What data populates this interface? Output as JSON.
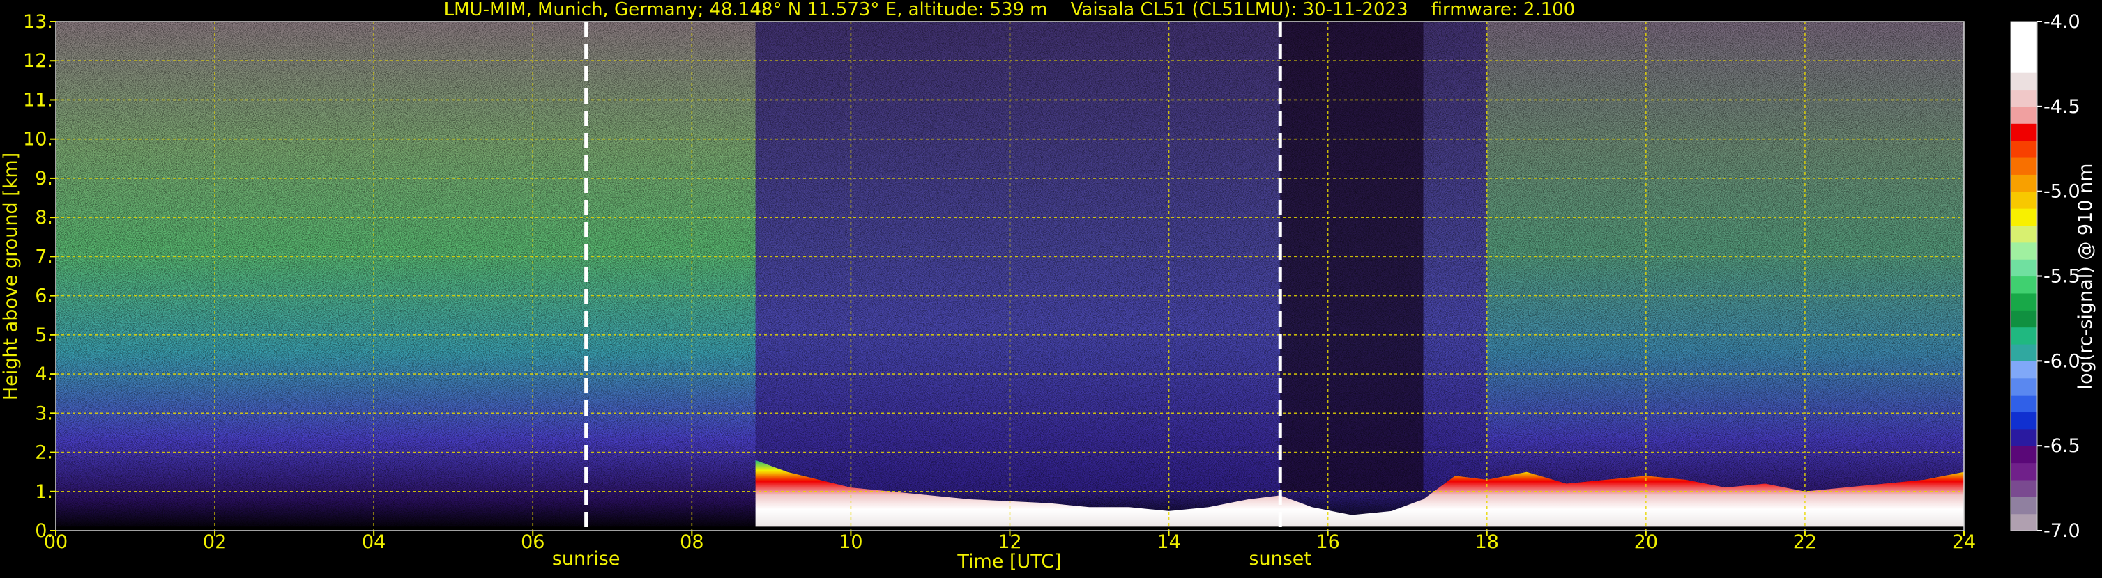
{
  "chart_data": {
    "type": "heatmap",
    "title": "LMU-MIM, Munich, Germany; 48.148° N 11.573° E, altitude: 539 m    Vaisala CL51 (CL51LMU): 30-11-2023    firmware: 2.100",
    "xlabel": "Time [UTC]",
    "ylabel": "Height above ground [km]",
    "xlim": [
      0,
      24
    ],
    "ylim": [
      0,
      13
    ],
    "x_ticks": [
      "00",
      "02",
      "04",
      "06",
      "08",
      "10",
      "12",
      "14",
      "16",
      "18",
      "20",
      "22",
      "24"
    ],
    "y_ticks": [
      "0.",
      "1.",
      "2.",
      "3.",
      "4.",
      "5.",
      "6.",
      "7.",
      "8.",
      "9.",
      "10.",
      "11.",
      "12.",
      "13."
    ],
    "grid": true,
    "vlines": [
      {
        "x": 6.67,
        "label": "sunrise"
      },
      {
        "x": 15.4,
        "label": "sunset"
      }
    ],
    "colorbar": {
      "label": "log(rc-signal) @ 910 nm",
      "range": [
        -7.0,
        -4.0
      ],
      "ticks": [
        "-4.0",
        "-4.5",
        "-5.0",
        "-5.5",
        "-6.0",
        "-6.5",
        "-7.0"
      ],
      "colors": [
        "#b0a0b0",
        "#9080a0",
        "#7a4a90",
        "#70208a",
        "#5a0878",
        "#2a1aa0",
        "#1030d0",
        "#3060e8",
        "#5a88f0",
        "#80a8f8",
        "#30a8a0",
        "#20b880",
        "#109040",
        "#18a848",
        "#40d070",
        "#70e0a0",
        "#a0f0a0",
        "#d8f070",
        "#f8f000",
        "#f8c800",
        "#f8a000",
        "#f87000",
        "#f84000",
        "#f00000",
        "#f0a0a0",
        "#f0c8c8",
        "#ece0e0",
        "#ffffff",
        "#ffffff",
        "#ffffff"
      ]
    },
    "boundary_layer_top_km": [
      [
        8.8,
        1.8
      ],
      [
        9.2,
        1.5
      ],
      [
        9.6,
        1.3
      ],
      [
        10.0,
        1.1
      ],
      [
        10.5,
        1.0
      ],
      [
        11.0,
        0.9
      ],
      [
        11.5,
        0.8
      ],
      [
        12.0,
        0.75
      ],
      [
        12.5,
        0.7
      ],
      [
        13.0,
        0.6
      ],
      [
        13.5,
        0.6
      ],
      [
        14.0,
        0.5
      ],
      [
        14.5,
        0.6
      ],
      [
        15.0,
        0.8
      ],
      [
        15.4,
        0.9
      ],
      [
        15.8,
        0.6
      ],
      [
        16.3,
        0.4
      ],
      [
        16.8,
        0.5
      ],
      [
        17.2,
        0.8
      ],
      [
        17.6,
        1.4
      ],
      [
        18.0,
        1.3
      ],
      [
        18.5,
        1.5
      ],
      [
        19.0,
        1.2
      ],
      [
        19.5,
        1.3
      ],
      [
        20.0,
        1.4
      ],
      [
        20.5,
        1.3
      ],
      [
        21.0,
        1.1
      ],
      [
        21.5,
        1.2
      ],
      [
        22.0,
        1.0
      ],
      [
        22.5,
        1.1
      ],
      [
        23.0,
        1.2
      ],
      [
        23.5,
        1.3
      ],
      [
        24.0,
        1.5
      ]
    ]
  }
}
